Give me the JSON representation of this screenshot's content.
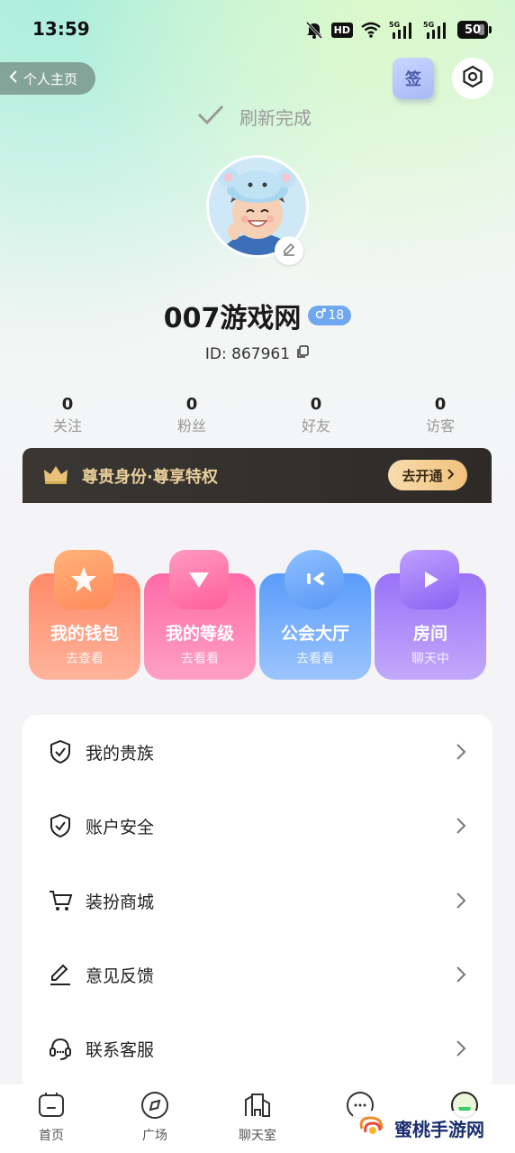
{
  "status_bar": {
    "time": "13:59",
    "hd_badge": "HD",
    "battery": "50"
  },
  "header": {
    "back_label": "个人主页",
    "sign_label": "签"
  },
  "refresh": {
    "text": "刷新完成"
  },
  "profile": {
    "nickname": "007游戏网",
    "gender_age": "18",
    "id_text": "ID: 867961"
  },
  "stats": [
    {
      "value": "0",
      "label": "关注"
    },
    {
      "value": "0",
      "label": "粉丝"
    },
    {
      "value": "0",
      "label": "好友"
    },
    {
      "value": "0",
      "label": "访客"
    }
  ],
  "vip": {
    "text": "尊贵身份·尊享特权",
    "button": "去开通"
  },
  "cards": [
    {
      "title": "我的钱包",
      "sub": "去查看",
      "icon": "star-icon"
    },
    {
      "title": "我的等级",
      "sub": "去看看",
      "icon": "triangle-icon"
    },
    {
      "title": "公会大厅",
      "sub": "去看看",
      "icon": "chat-bubble-icon"
    },
    {
      "title": "房间",
      "sub": "聊天中",
      "icon": "play-icon"
    }
  ],
  "menu": [
    {
      "label": "我的贵族",
      "icon": "shield-check-icon"
    },
    {
      "label": "账户安全",
      "icon": "shield-check-icon"
    },
    {
      "label": "装扮商城",
      "icon": "cart-icon"
    },
    {
      "label": "意见反馈",
      "icon": "pencil-icon"
    },
    {
      "label": "联系客服",
      "icon": "headset-icon"
    }
  ],
  "nav": [
    {
      "label": "首页",
      "icon": "home-icon"
    },
    {
      "label": "广场",
      "icon": "compass-icon"
    },
    {
      "label": "聊天室",
      "icon": "building-icon"
    },
    {
      "label": "",
      "icon": "message-icon"
    },
    {
      "label": "",
      "icon": "profile-icon"
    }
  ],
  "watermark": {
    "text": "蜜桃手游网"
  },
  "colors": {
    "vip_gold": "#e9cf9a",
    "wallet": "#ff8a68",
    "level": "#ff6aa6",
    "guild": "#5a9cfa",
    "room": "#9a72f7"
  }
}
